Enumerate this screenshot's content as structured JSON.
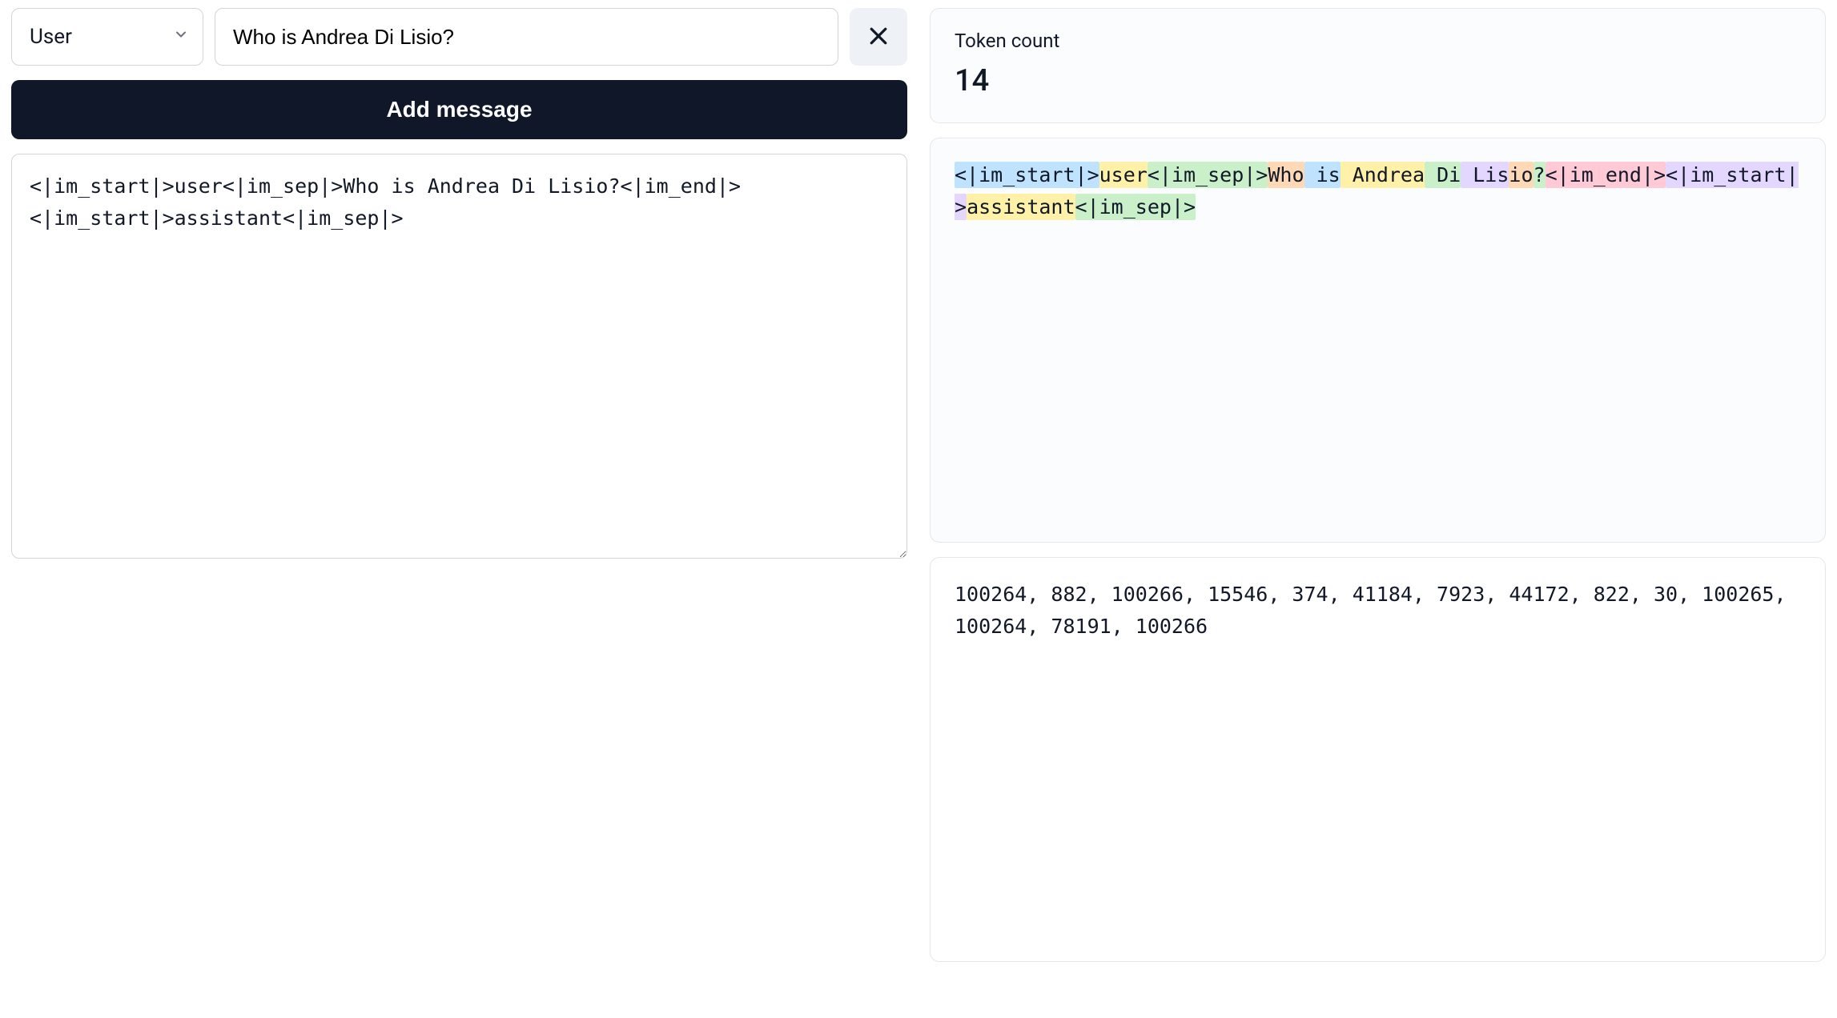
{
  "role_select": {
    "value": "User"
  },
  "message_input": {
    "value": "Who is Andrea Di Lisio?"
  },
  "add_message_button": {
    "label": "Add message"
  },
  "raw_textarea": {
    "value": "<|im_start|>user<|im_sep|>Who is Andrea Di Lisio?<|im_end|>\n<|im_start|>assistant<|im_sep|>"
  },
  "token_count": {
    "label": "Token count",
    "value": "14"
  },
  "tokenized": {
    "tokens": [
      {
        "text": "<|im_start|>",
        "color": "c0"
      },
      {
        "text": "user",
        "color": "c1"
      },
      {
        "text": "<|im_sep|>",
        "color": "c2"
      },
      {
        "text": "Who",
        "color": "c3"
      },
      {
        "text": " is",
        "color": "c0"
      },
      {
        "text": " Andrea",
        "color": "c1"
      },
      {
        "text": " Di",
        "color": "c2"
      },
      {
        "text": " Lis",
        "color": "c4"
      },
      {
        "text": "io",
        "color": "c3"
      },
      {
        "text": "?",
        "color": "c2"
      },
      {
        "text": "<|im_end|>",
        "color": "c5"
      },
      {
        "text": "<|im_start|>",
        "color": "c4"
      },
      {
        "text": "assistant",
        "color": "c1"
      },
      {
        "text": "<|im_sep|>",
        "color": "c2"
      }
    ]
  },
  "token_ids": {
    "text": "100264, 882, 100266, 15546, 374, 41184, 7923, 44172, 822, 30, 100265, 100264, 78191, 100266"
  }
}
